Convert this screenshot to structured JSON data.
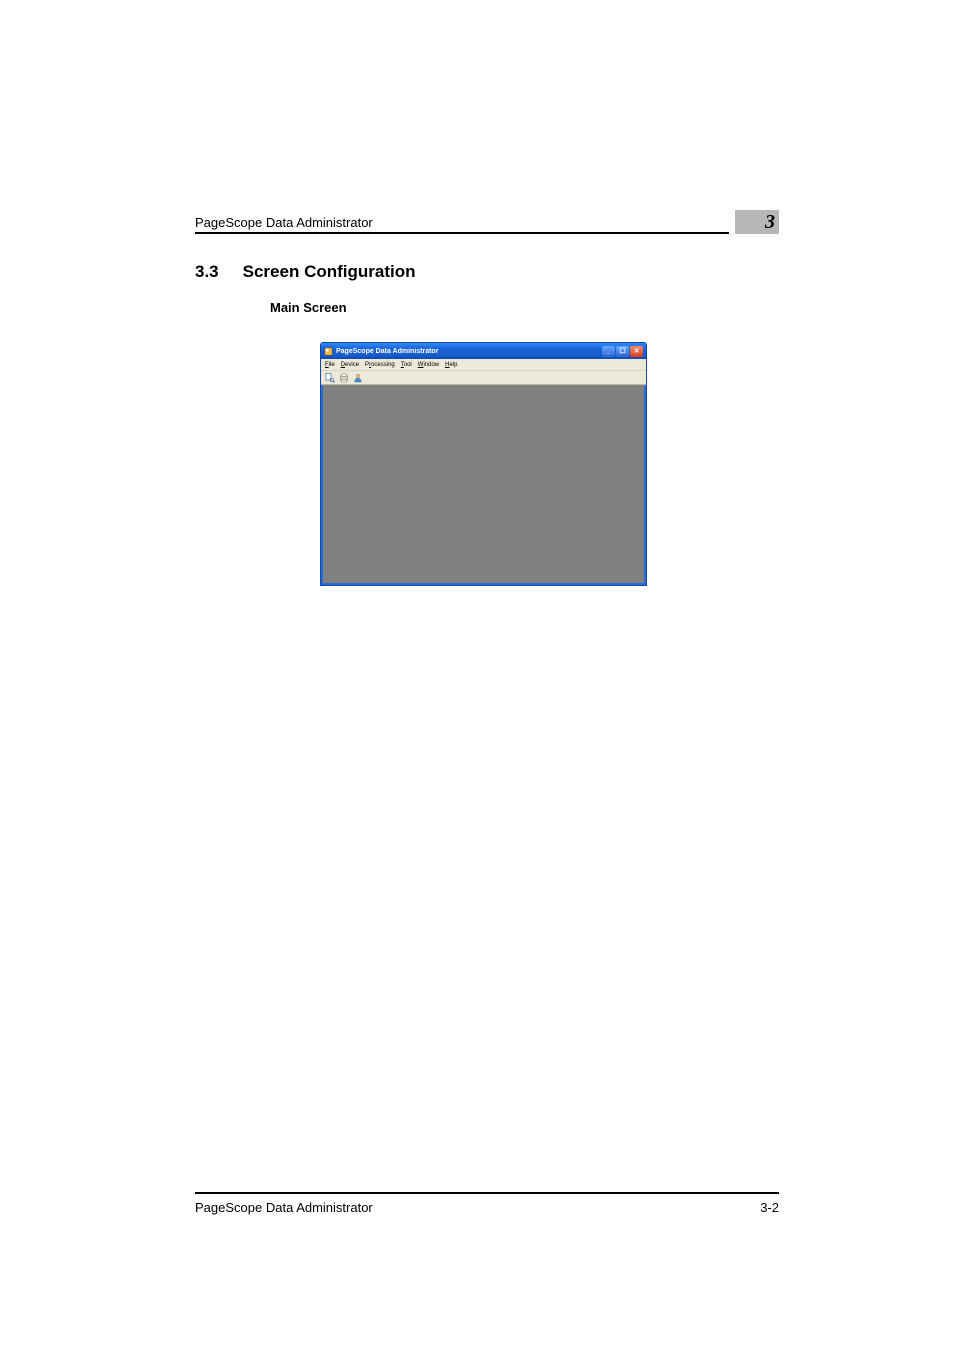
{
  "page_header_title": "PageScope Data Administrator",
  "chapter_number": "3",
  "section_number": "3.3",
  "section_title": "Screen Configuration",
  "subsection_title": "Main Screen",
  "window": {
    "title": "PageScope Data Administrator",
    "menu": {
      "file": "File",
      "device": "Device",
      "processing": "Processing",
      "tool": "Tool",
      "window": "Window",
      "help": "Help"
    }
  },
  "footer_title": "PageScope Data Administrator",
  "footer_page": "3-2"
}
